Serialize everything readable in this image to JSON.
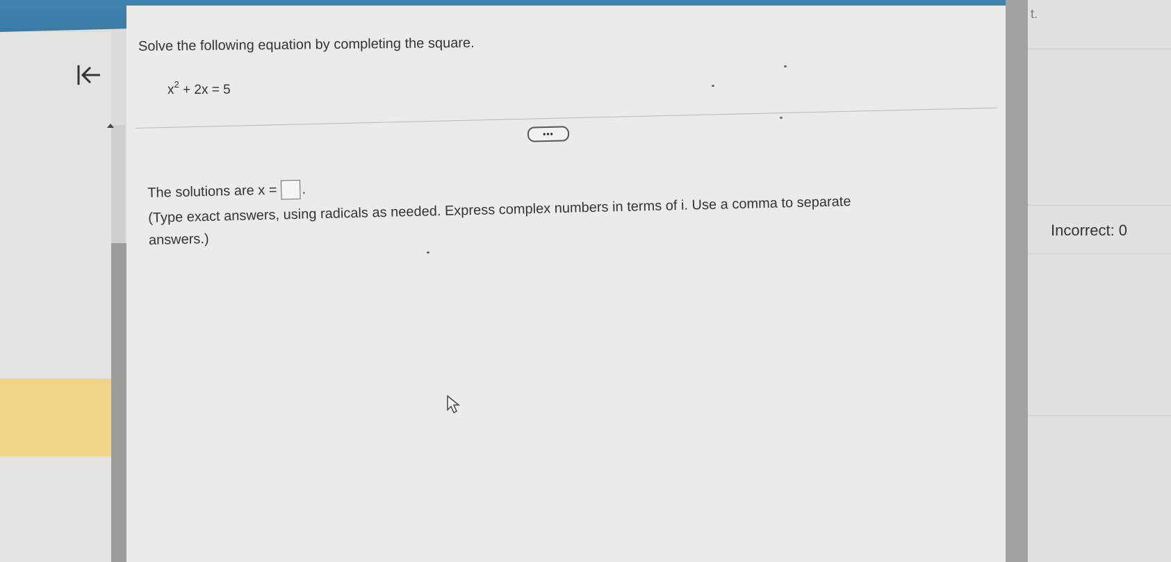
{
  "header": {
    "color": "#3d80ab"
  },
  "nav": {
    "back_icon": "first-page-arrow-icon"
  },
  "question": {
    "instruction": "Solve the following equation by completing the square.",
    "equation": {
      "base": "x",
      "exponent": "2",
      "rest": " + 2x = 5"
    },
    "more_label": "•••"
  },
  "answer": {
    "prefix": "The solutions are x =",
    "value": "",
    "suffix": ".",
    "hint": "(Type exact answers, using radicals as needed. Express complex numbers in terms of i. Use a comma to separate answers.)"
  },
  "side_panel": {
    "top_text": "t.",
    "incorrect_label": "Incorrect: 0"
  },
  "colors": {
    "highlight": "#f2d488",
    "scrollbar": "#a2a2a0"
  }
}
